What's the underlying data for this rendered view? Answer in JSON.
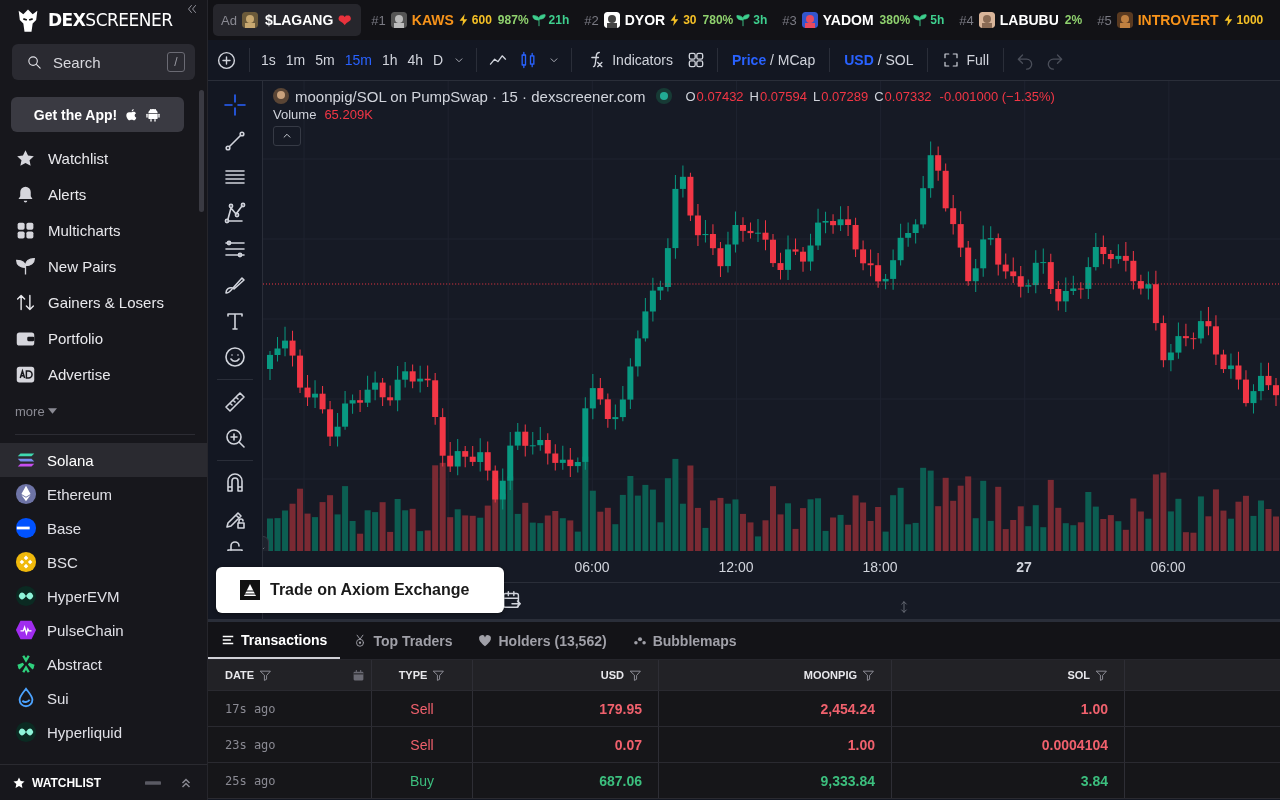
{
  "sidebar": {
    "logo": "**DEX**SCREENER",
    "search": {
      "placeholder": "Search",
      "shortcut": "/"
    },
    "app_button": "Get the App!",
    "nav": [
      {
        "label": "Watchlist"
      },
      {
        "label": "Alerts"
      },
      {
        "label": "Multicharts"
      },
      {
        "label": "New Pairs"
      },
      {
        "label": "Gainers & Losers"
      },
      {
        "label": "Portfolio"
      },
      {
        "label": "Advertise"
      }
    ],
    "more": "more",
    "chains": [
      {
        "label": "Solana",
        "selected": true
      },
      {
        "label": "Ethereum",
        "selected": false
      },
      {
        "label": "Base",
        "selected": false
      },
      {
        "label": "BSC",
        "selected": false
      },
      {
        "label": "HyperEVM",
        "selected": false
      },
      {
        "label": "PulseChain",
        "selected": false
      },
      {
        "label": "Abstract",
        "selected": false
      },
      {
        "label": "Sui",
        "selected": false
      },
      {
        "label": "Hyperliquid",
        "selected": false
      }
    ],
    "watchlist_bar": "WATCHLIST"
  },
  "ticker": [
    {
      "kind": "ad",
      "tag": "Ad",
      "name": "$LAGANG",
      "heart": "❤"
    },
    {
      "kind": "ranked",
      "rank": "#1",
      "name": "KAWS",
      "color": "#f7931a",
      "boost": "600",
      "change": "987%",
      "age": "21h"
    },
    {
      "kind": "ranked",
      "rank": "#2",
      "name": "DYOR",
      "color": "#ffffff",
      "boost": "30",
      "change": "780%",
      "age": "3h"
    },
    {
      "kind": "ranked",
      "rank": "#3",
      "name": "YADOM",
      "color": "#ffffff",
      "change": "380%",
      "age": "5h"
    },
    {
      "kind": "ranked",
      "rank": "#4",
      "name": "LABUBU",
      "color": "#ffffff",
      "change": "2%"
    },
    {
      "kind": "ranked",
      "rank": "#5",
      "name": "INTROVERT",
      "color": "#f7931a",
      "boost": "1000"
    }
  ],
  "toolbar": {
    "intervals": [
      {
        "label": "1s",
        "selected": false
      },
      {
        "label": "1m",
        "selected": false
      },
      {
        "label": "5m",
        "selected": false
      },
      {
        "label": "15m",
        "selected": true
      },
      {
        "label": "1h",
        "selected": false
      },
      {
        "label": "4h",
        "selected": false
      },
      {
        "label": "D",
        "selected": false
      }
    ],
    "chart_types": [
      {
        "selected": false
      },
      {
        "selected": true
      }
    ],
    "indicators": "Indicators",
    "price_mode": {
      "separator": "/",
      "options": [
        {
          "label": "Price",
          "selected": true
        },
        {
          "label": "MCap",
          "selected": false
        }
      ]
    },
    "currency": {
      "separator": "/",
      "options": [
        {
          "label": "USD",
          "selected": true
        },
        {
          "label": "SOL",
          "selected": false
        }
      ]
    },
    "full": "Full",
    "history": [
      {
        "disabled": true
      },
      {
        "disabled": true
      }
    ]
  },
  "chart": {
    "title": "moonpig/SOL on PumpSwap · 15 · dexscreener.com",
    "ohlc": [
      {
        "key": "O",
        "value": "0.07432"
      },
      {
        "key": "H",
        "value": "0.07594"
      },
      {
        "key": "L",
        "value": "0.07289"
      },
      {
        "key": "C",
        "value": "0.07332"
      }
    ],
    "change": "-0.001000 (−1.35%)",
    "volume_label": "Volume",
    "volume": "65.209K",
    "tools": [
      {
        "selected": true
      },
      {
        "selected": false
      },
      {
        "selected": false
      },
      {
        "selected": false
      },
      {
        "selected": false
      },
      {
        "selected": false
      },
      {
        "selected": false
      },
      {
        "selected": false
      },
      {
        "selected": false
      },
      {
        "selected": false
      },
      {
        "selected": false
      },
      {
        "selected": false
      },
      {
        "selected": false
      }
    ],
    "time_labels": [
      {
        "label": "06:00",
        "kind": "time"
      },
      {
        "label": "12:00",
        "kind": "time"
      },
      {
        "label": "18:00",
        "kind": "time"
      },
      {
        "label": "27",
        "kind": "day"
      },
      {
        "label": "06:00",
        "kind": "time"
      }
    ],
    "trade_button": "Trade on Axiom Exchange"
  },
  "tabs": [
    {
      "label": "Transactions",
      "selected": true
    },
    {
      "label": "Top Traders",
      "selected": false
    },
    {
      "label": "Holders (13,562)",
      "selected": false
    },
    {
      "label": "Bubblemaps",
      "selected": false
    }
  ],
  "table": {
    "columns": [
      "DATE",
      "TYPE",
      "USD",
      "MOONPIG",
      "SOL"
    ],
    "rows": [
      {
        "date": "17s ago",
        "type": "Sell",
        "kind": "sell",
        "usd": "179.95",
        "moonpig": "2,454.24",
        "sol": "1.00"
      },
      {
        "date": "23s ago",
        "type": "Sell",
        "kind": "sell",
        "usd": "0.07",
        "moonpig": "1.00",
        "sol": "0.0004104"
      },
      {
        "date": "25s ago",
        "type": "Buy",
        "kind": "buy",
        "usd": "687.06",
        "moonpig": "9,333.84",
        "sol": "3.84"
      }
    ]
  }
}
